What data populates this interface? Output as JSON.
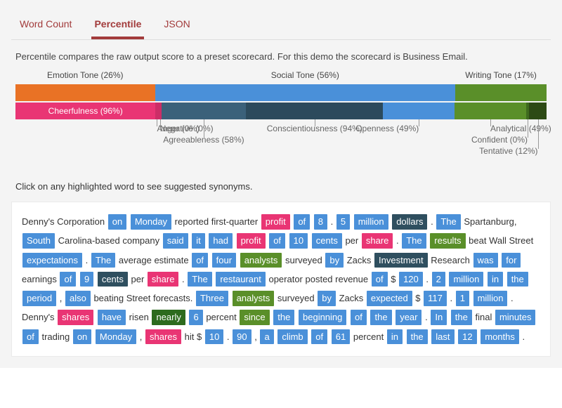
{
  "tabs": [
    "Word Count",
    "Percentile",
    "JSON"
  ],
  "active_tab": 1,
  "description": "Percentile compares the raw output score to a preset scorecard. For this demo the scorecard is Business Email.",
  "instruction": "Click on any highlighted word to see suggested synonyms.",
  "chart_data": {
    "type": "bar",
    "title": "",
    "top_groups": [
      {
        "name": "Emotion Tone",
        "pct": 26,
        "color": "#e97225"
      },
      {
        "name": "Social Tone",
        "pct": 56,
        "color": "#4a90d9"
      },
      {
        "name": "Writing Tone",
        "pct": 17,
        "color": "#5a8f29"
      }
    ],
    "bottom_segments": [
      {
        "name": "Cheerfulness",
        "pct": 96,
        "color": "#e93574",
        "group": "Emotion Tone"
      },
      {
        "name": "Anger",
        "pct": 0,
        "color": "#cc2e67",
        "group": "Emotion Tone"
      },
      {
        "name": "Negative",
        "pct": 0,
        "color": "#cc2e67",
        "group": "Emotion Tone"
      },
      {
        "name": "Agreeableness",
        "pct": 58,
        "color": "#3b617a",
        "group": "Social Tone"
      },
      {
        "name": "Conscientiousness",
        "pct": 94,
        "color": "#2c4a5c",
        "group": "Social Tone"
      },
      {
        "name": "Openness",
        "pct": 49,
        "color": "#4a90d9",
        "group": "Social Tone"
      },
      {
        "name": "Analytical",
        "pct": 49,
        "color": "#5a8f29",
        "group": "Writing Tone"
      },
      {
        "name": "Confident",
        "pct": 0,
        "color": "#3f6b1e",
        "group": "Writing Tone"
      },
      {
        "name": "Tentative",
        "pct": 12,
        "color": "#2d4a15",
        "group": "Writing Tone"
      }
    ]
  },
  "tokens": [
    {
      "t": "Denny's Corporation ",
      "c": null
    },
    {
      "t": "on",
      "c": "h-blue"
    },
    {
      "t": " ",
      "c": null
    },
    {
      "t": "Monday",
      "c": "h-blue"
    },
    {
      "t": " reported first-quarter ",
      "c": null
    },
    {
      "t": "profit",
      "c": "h-pink"
    },
    {
      "t": " ",
      "c": null
    },
    {
      "t": "of",
      "c": "h-blue"
    },
    {
      "t": " ",
      "c": null
    },
    {
      "t": "8",
      "c": "h-blue"
    },
    {
      "t": " . ",
      "c": null
    },
    {
      "t": "5",
      "c": "h-blue"
    },
    {
      "t": " ",
      "c": null
    },
    {
      "t": "million",
      "c": "h-blue"
    },
    {
      "t": " ",
      "c": null
    },
    {
      "t": "dollars",
      "c": "h-teal"
    },
    {
      "t": " . ",
      "c": null
    },
    {
      "t": "The",
      "c": "h-blue"
    },
    {
      "t": " Spartanburg, ",
      "c": null
    },
    {
      "t": "South",
      "c": "h-blue"
    },
    {
      "t": " Carolina-based company ",
      "c": null
    },
    {
      "t": "said",
      "c": "h-blue"
    },
    {
      "t": " ",
      "c": null
    },
    {
      "t": "it",
      "c": "h-blue"
    },
    {
      "t": " ",
      "c": null
    },
    {
      "t": "had",
      "c": "h-blue"
    },
    {
      "t": " ",
      "c": null
    },
    {
      "t": "profit",
      "c": "h-pink"
    },
    {
      "t": " ",
      "c": null
    },
    {
      "t": "of",
      "c": "h-blue"
    },
    {
      "t": " ",
      "c": null
    },
    {
      "t": "10",
      "c": "h-blue"
    },
    {
      "t": " ",
      "c": null
    },
    {
      "t": "cents",
      "c": "h-blue"
    },
    {
      "t": " per ",
      "c": null
    },
    {
      "t": "share",
      "c": "h-pink"
    },
    {
      "t": " . ",
      "c": null
    },
    {
      "t": "The",
      "c": "h-blue"
    },
    {
      "t": " ",
      "c": null
    },
    {
      "t": "results",
      "c": "h-green"
    },
    {
      "t": " beat Wall Street ",
      "c": null
    },
    {
      "t": "expectations",
      "c": "h-blue"
    },
    {
      "t": " . ",
      "c": null
    },
    {
      "t": "The",
      "c": "h-blue"
    },
    {
      "t": " average estimate ",
      "c": null
    },
    {
      "t": "of",
      "c": "h-blue"
    },
    {
      "t": " ",
      "c": null
    },
    {
      "t": "four",
      "c": "h-blue"
    },
    {
      "t": " ",
      "c": null
    },
    {
      "t": "analysts",
      "c": "h-green"
    },
    {
      "t": " surveyed ",
      "c": null
    },
    {
      "t": "by",
      "c": "h-blue"
    },
    {
      "t": " Zacks ",
      "c": null
    },
    {
      "t": "Investment",
      "c": "h-teal"
    },
    {
      "t": " Research ",
      "c": null
    },
    {
      "t": "was",
      "c": "h-blue"
    },
    {
      "t": " ",
      "c": null
    },
    {
      "t": "for",
      "c": "h-blue"
    },
    {
      "t": " earnings ",
      "c": null
    },
    {
      "t": "of",
      "c": "h-blue"
    },
    {
      "t": " ",
      "c": null
    },
    {
      "t": "9",
      "c": "h-blue"
    },
    {
      "t": " ",
      "c": null
    },
    {
      "t": "cents",
      "c": "h-teal"
    },
    {
      "t": " per ",
      "c": null
    },
    {
      "t": "share",
      "c": "h-pink"
    },
    {
      "t": " . ",
      "c": null
    },
    {
      "t": "The",
      "c": "h-blue"
    },
    {
      "t": " ",
      "c": null
    },
    {
      "t": "restaurant",
      "c": "h-blue"
    },
    {
      "t": " operator posted revenue ",
      "c": null
    },
    {
      "t": "of",
      "c": "h-blue"
    },
    {
      "t": " $ ",
      "c": null
    },
    {
      "t": "120",
      "c": "h-blue"
    },
    {
      "t": " . ",
      "c": null
    },
    {
      "t": "2",
      "c": "h-blue"
    },
    {
      "t": " ",
      "c": null
    },
    {
      "t": "million",
      "c": "h-blue"
    },
    {
      "t": " ",
      "c": null
    },
    {
      "t": "in",
      "c": "h-blue"
    },
    {
      "t": " ",
      "c": null
    },
    {
      "t": "the",
      "c": "h-blue"
    },
    {
      "t": " ",
      "c": null
    },
    {
      "t": "period",
      "c": "h-blue"
    },
    {
      "t": " , ",
      "c": null
    },
    {
      "t": "also",
      "c": "h-blue"
    },
    {
      "t": " beating Street forecasts. ",
      "c": null
    },
    {
      "t": "Three",
      "c": "h-blue"
    },
    {
      "t": " ",
      "c": null
    },
    {
      "t": "analysts",
      "c": "h-green"
    },
    {
      "t": " surveyed ",
      "c": null
    },
    {
      "t": "by",
      "c": "h-blue"
    },
    {
      "t": " Zacks ",
      "c": null
    },
    {
      "t": "expected",
      "c": "h-blue"
    },
    {
      "t": " $ ",
      "c": null
    },
    {
      "t": "117",
      "c": "h-blue"
    },
    {
      "t": " . ",
      "c": null
    },
    {
      "t": "1",
      "c": "h-blue"
    },
    {
      "t": " ",
      "c": null
    },
    {
      "t": "million",
      "c": "h-blue"
    },
    {
      "t": " . Denny's ",
      "c": null
    },
    {
      "t": "shares",
      "c": "h-pink"
    },
    {
      "t": " ",
      "c": null
    },
    {
      "t": "have",
      "c": "h-blue"
    },
    {
      "t": " risen ",
      "c": null
    },
    {
      "t": "nearly",
      "c": "h-dgreen"
    },
    {
      "t": " ",
      "c": null
    },
    {
      "t": "6",
      "c": "h-blue"
    },
    {
      "t": " percent ",
      "c": null
    },
    {
      "t": "since",
      "c": "h-green"
    },
    {
      "t": " ",
      "c": null
    },
    {
      "t": "the",
      "c": "h-blue"
    },
    {
      "t": " ",
      "c": null
    },
    {
      "t": "beginning",
      "c": "h-blue"
    },
    {
      "t": " ",
      "c": null
    },
    {
      "t": "of",
      "c": "h-blue"
    },
    {
      "t": " ",
      "c": null
    },
    {
      "t": "the",
      "c": "h-blue"
    },
    {
      "t": " ",
      "c": null
    },
    {
      "t": "year",
      "c": "h-blue"
    },
    {
      "t": " . ",
      "c": null
    },
    {
      "t": "In",
      "c": "h-blue"
    },
    {
      "t": " ",
      "c": null
    },
    {
      "t": "the",
      "c": "h-blue"
    },
    {
      "t": " final ",
      "c": null
    },
    {
      "t": "minutes",
      "c": "h-blue"
    },
    {
      "t": " ",
      "c": null
    },
    {
      "t": "of",
      "c": "h-blue"
    },
    {
      "t": " trading ",
      "c": null
    },
    {
      "t": "on",
      "c": "h-blue"
    },
    {
      "t": " ",
      "c": null
    },
    {
      "t": "Monday",
      "c": "h-blue"
    },
    {
      "t": " , ",
      "c": null
    },
    {
      "t": "shares",
      "c": "h-pink"
    },
    {
      "t": " hit $ ",
      "c": null
    },
    {
      "t": "10",
      "c": "h-blue"
    },
    {
      "t": " . ",
      "c": null
    },
    {
      "t": "90",
      "c": "h-blue"
    },
    {
      "t": " , ",
      "c": null
    },
    {
      "t": "a",
      "c": "h-blue"
    },
    {
      "t": " ",
      "c": null
    },
    {
      "t": "climb",
      "c": "h-blue"
    },
    {
      "t": " ",
      "c": null
    },
    {
      "t": "of",
      "c": "h-blue"
    },
    {
      "t": " ",
      "c": null
    },
    {
      "t": "61",
      "c": "h-blue"
    },
    {
      "t": " percent ",
      "c": null
    },
    {
      "t": "in",
      "c": "h-blue"
    },
    {
      "t": " ",
      "c": null
    },
    {
      "t": "the",
      "c": "h-blue"
    },
    {
      "t": " ",
      "c": null
    },
    {
      "t": "last",
      "c": "h-blue"
    },
    {
      "t": " ",
      "c": null
    },
    {
      "t": "12",
      "c": "h-blue"
    },
    {
      "t": " ",
      "c": null
    },
    {
      "t": "months",
      "c": "h-blue"
    },
    {
      "t": " .",
      "c": null
    }
  ]
}
